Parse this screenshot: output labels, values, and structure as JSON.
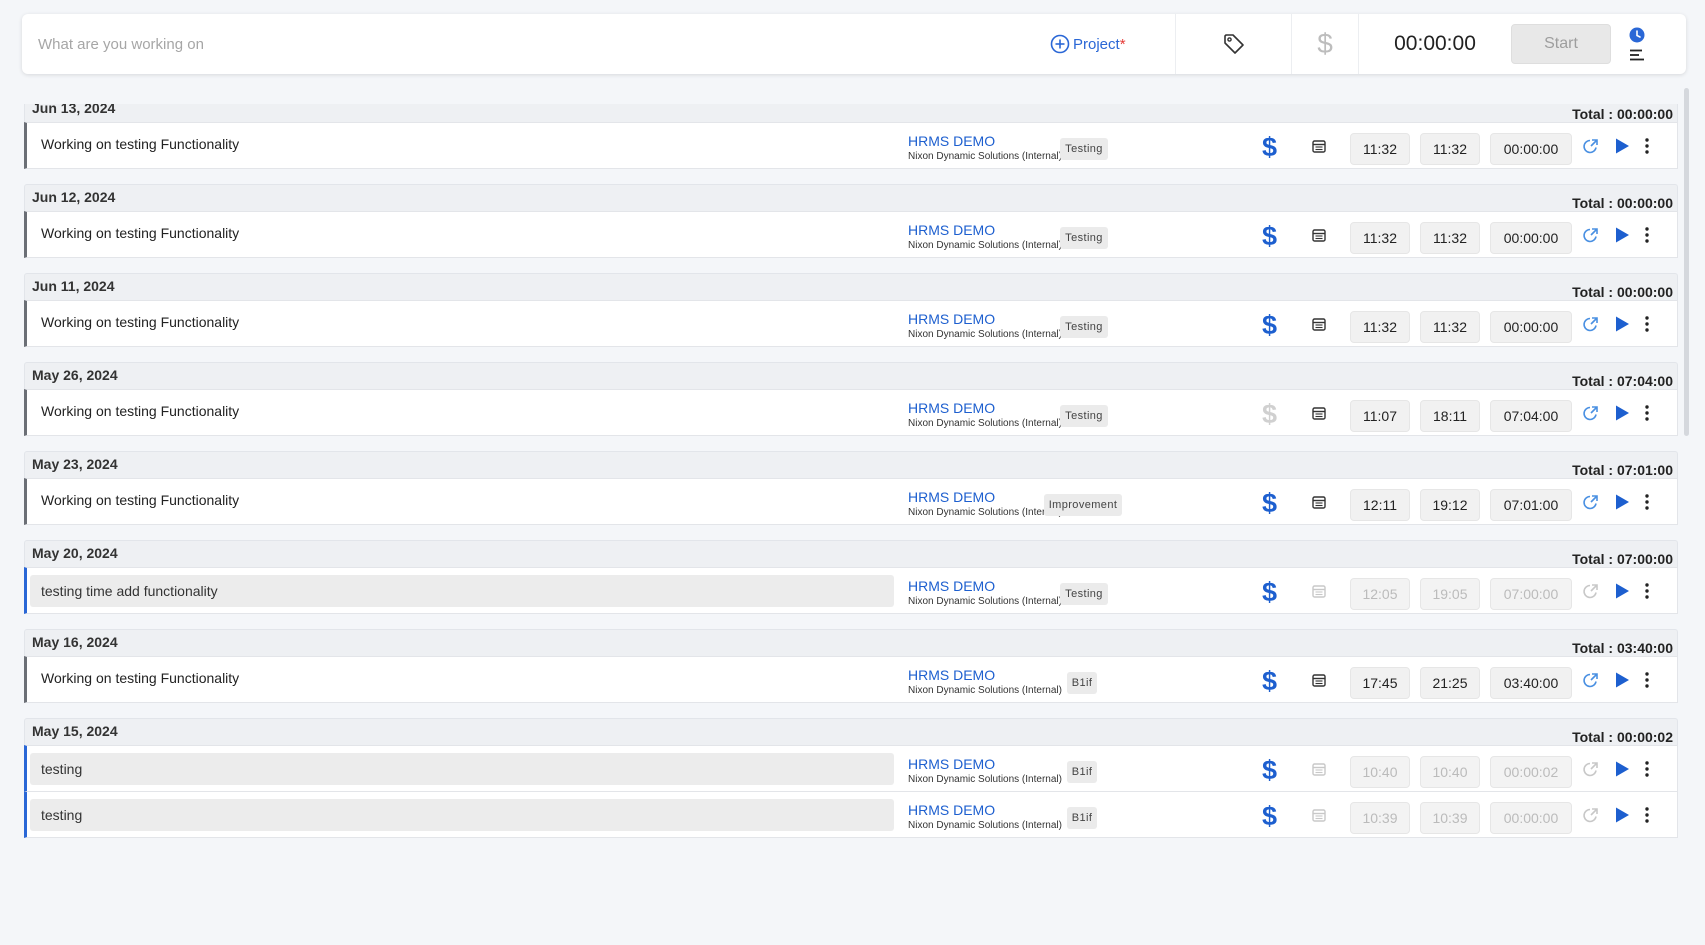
{
  "tracker": {
    "placeholder": "What are you working on",
    "project_label": "Project",
    "project_required": "*",
    "dollar_symbol": "$",
    "timer": "00:00:00",
    "start_label": "Start",
    "accent_color": "#2a67d6"
  },
  "dollar_symbol": "$",
  "days": [
    {
      "date": "Jun 13, 2024",
      "total": "Total : 00:00:00",
      "entries": [
        {
          "description": "Working on testing Functionality",
          "project": "HRMS DEMO",
          "client": "Nixon Dynamic Solutions (Internal)",
          "tag": "Testing",
          "billable": true,
          "start": "11:32",
          "end": "11:32",
          "duration": "00:00:00",
          "editable": true,
          "left_bar": "gray"
        }
      ]
    },
    {
      "date": "Jun 12, 2024",
      "total": "Total : 00:00:00",
      "entries": [
        {
          "description": "Working on testing Functionality",
          "project": "HRMS DEMO",
          "client": "Nixon Dynamic Solutions (Internal)",
          "tag": "Testing",
          "billable": true,
          "start": "11:32",
          "end": "11:32",
          "duration": "00:00:00",
          "editable": true,
          "left_bar": "gray"
        }
      ]
    },
    {
      "date": "Jun 11, 2024",
      "total": "Total : 00:00:00",
      "entries": [
        {
          "description": "Working on testing Functionality",
          "project": "HRMS DEMO",
          "client": "Nixon Dynamic Solutions (Internal)",
          "tag": "Testing",
          "billable": true,
          "start": "11:32",
          "end": "11:32",
          "duration": "00:00:00",
          "editable": true,
          "left_bar": "gray"
        }
      ]
    },
    {
      "date": "May 26, 2024",
      "total": "Total : 07:04:00",
      "entries": [
        {
          "description": "Working on testing Functionality",
          "project": "HRMS DEMO",
          "client": "Nixon Dynamic Solutions (Internal)",
          "tag": "Testing",
          "billable": false,
          "start": "11:07",
          "end": "18:11",
          "duration": "07:04:00",
          "editable": true,
          "left_bar": "gray"
        }
      ]
    },
    {
      "date": "May 23, 2024",
      "total": "Total : 07:01:00",
      "entries": [
        {
          "description": "Working on testing Functionality",
          "project": "HRMS DEMO",
          "client": "Nixon Dynamic Solutions (Internal)",
          "tag": "Improvement",
          "billable": true,
          "start": "12:11",
          "end": "19:12",
          "duration": "07:01:00",
          "editable": true,
          "left_bar": "gray"
        }
      ]
    },
    {
      "date": "May 20, 2024",
      "total": "Total : 07:00:00",
      "entries": [
        {
          "description": "testing time add functionality",
          "project": "HRMS DEMO",
          "client": "Nixon Dynamic Solutions (Internal)",
          "tag": "Testing",
          "billable": true,
          "start": "12:05",
          "end": "19:05",
          "duration": "07:00:00",
          "editable": false,
          "left_bar": "blue"
        }
      ]
    },
    {
      "date": "May 16, 2024",
      "total": "Total : 03:40:00",
      "entries": [
        {
          "description": "Working on testing Functionality",
          "project": "HRMS DEMO",
          "client": "Nixon Dynamic Solutions (Internal)",
          "tag": "B1if",
          "billable": true,
          "start": "17:45",
          "end": "21:25",
          "duration": "03:40:00",
          "editable": true,
          "left_bar": "gray"
        }
      ]
    },
    {
      "date": "May 15, 2024",
      "total": "Total : 00:00:02",
      "entries": [
        {
          "description": "testing",
          "project": "HRMS DEMO",
          "client": "Nixon Dynamic Solutions (Internal)",
          "tag": "B1if",
          "billable": true,
          "start": "10:40",
          "end": "10:40",
          "duration": "00:00:02",
          "editable": false,
          "left_bar": "blue"
        },
        {
          "description": "testing",
          "project": "HRMS DEMO",
          "client": "Nixon Dynamic Solutions (Internal)",
          "tag": "B1if",
          "billable": true,
          "start": "10:39",
          "end": "10:39",
          "duration": "00:00:00",
          "editable": false,
          "left_bar": "blue"
        }
      ]
    }
  ]
}
